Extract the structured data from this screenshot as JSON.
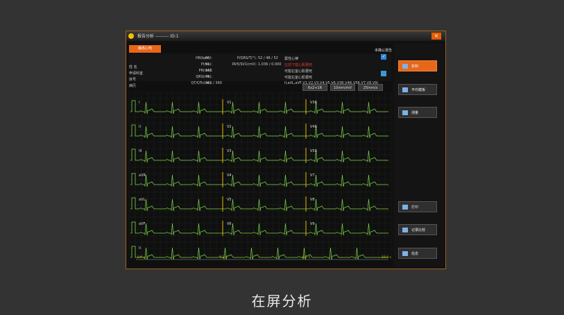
{
  "window": {
    "title": "报告分析 --------- ID:1",
    "close_label": "×"
  },
  "tab_label": "静态心电",
  "confirm_label": "未确认报告",
  "patient": {
    "name_label": "姓 名",
    "dept_label": "申请科室",
    "bed_label": "床号",
    "illness_label": "病历"
  },
  "measurements": [
    {
      "label": "HR(bpm):",
      "value": "60"
    },
    {
      "label": "P(ms):",
      "value": "91"
    },
    {
      "label": "PR(ms):",
      "value": "165"
    },
    {
      "label": "QRS(ms):",
      "value": "76"
    },
    {
      "label": "QT/QTc(ms):",
      "value": "361  /  360"
    }
  ],
  "axis_info": [
    {
      "label": "P/QRS/T(°):",
      "value": "52   / 48   / 52"
    },
    {
      "label": "RV5/SV1(mV):",
      "value": "1.036  / 0.000"
    }
  ],
  "diagnosis": [
    {
      "text": "窦性心律",
      "color": "#cccccc"
    },
    {
      "text": "左前下壁心肌梗死",
      "color": "#e63a2a"
    },
    {
      "text": "可能右室心肌梗死",
      "color": "#cccccc"
    },
    {
      "text": "可能右室心肌梗死",
      "color": "#cccccc"
    },
    {
      "text": "II,aVL,aVF,V1,V2,V3,V4,V5,V6,V3R,V4R,V5R,V7,V8,V9)",
      "color": "#cccccc"
    }
  ],
  "toolbar": {
    "layout": "6x2+1R",
    "gain": "10mm/mV",
    "speed": "25mm/s"
  },
  "leads": {
    "col1": [
      "I",
      "II",
      "III",
      "aVR",
      "aVL",
      "aVF",
      "II"
    ],
    "col2": [
      "V1",
      "V2",
      "V3",
      "V4",
      "V5",
      "V6"
    ],
    "col3": [
      "V3R",
      "V4R",
      "V5R",
      "V7",
      "V8",
      "V9"
    ]
  },
  "time_axis": [
    "0.0 s",
    "3.3 s",
    "6.7 s",
    "10.0 s"
  ],
  "side_buttons": [
    {
      "label": "复制",
      "icon": "copy-icon",
      "active": true
    },
    {
      "label": "平均模板",
      "icon": "template-icon",
      "active": false
    },
    {
      "label": "测量",
      "icon": "measure-icon",
      "active": false
    },
    {
      "label": "打印",
      "icon": "print-icon",
      "active": false
    },
    {
      "label": "记录比较",
      "icon": "compare-icon",
      "active": false
    },
    {
      "label": "信息",
      "icon": "info-icon",
      "active": false
    }
  ],
  "colors": {
    "accent": "#e8661a",
    "trace": "#7fd84a",
    "marker": "#e0c000"
  },
  "caption": "在屏分析"
}
